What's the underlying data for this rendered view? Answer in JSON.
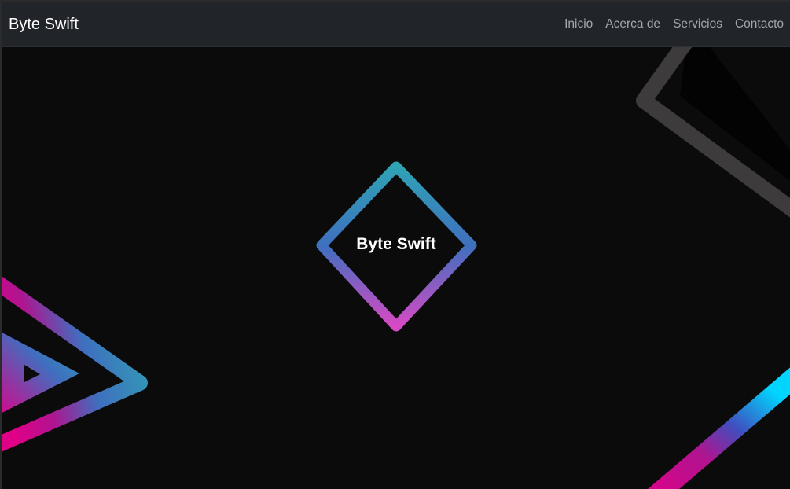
{
  "navbar": {
    "brand": "Byte Swift",
    "links": [
      {
        "label": "Inicio"
      },
      {
        "label": "Acerca de"
      },
      {
        "label": "Servicios"
      },
      {
        "label": "Contacto"
      }
    ]
  },
  "hero": {
    "title": "Byte Swift"
  },
  "colors": {
    "background": "#0b0b0b",
    "navbar": "#212529",
    "accent_teal": "#2fa3b4",
    "accent_blue": "#3f6fbf",
    "accent_magenta": "#d4008a",
    "accent_cyan": "#00d4ff",
    "shape_gray": "#3d3b3c"
  }
}
